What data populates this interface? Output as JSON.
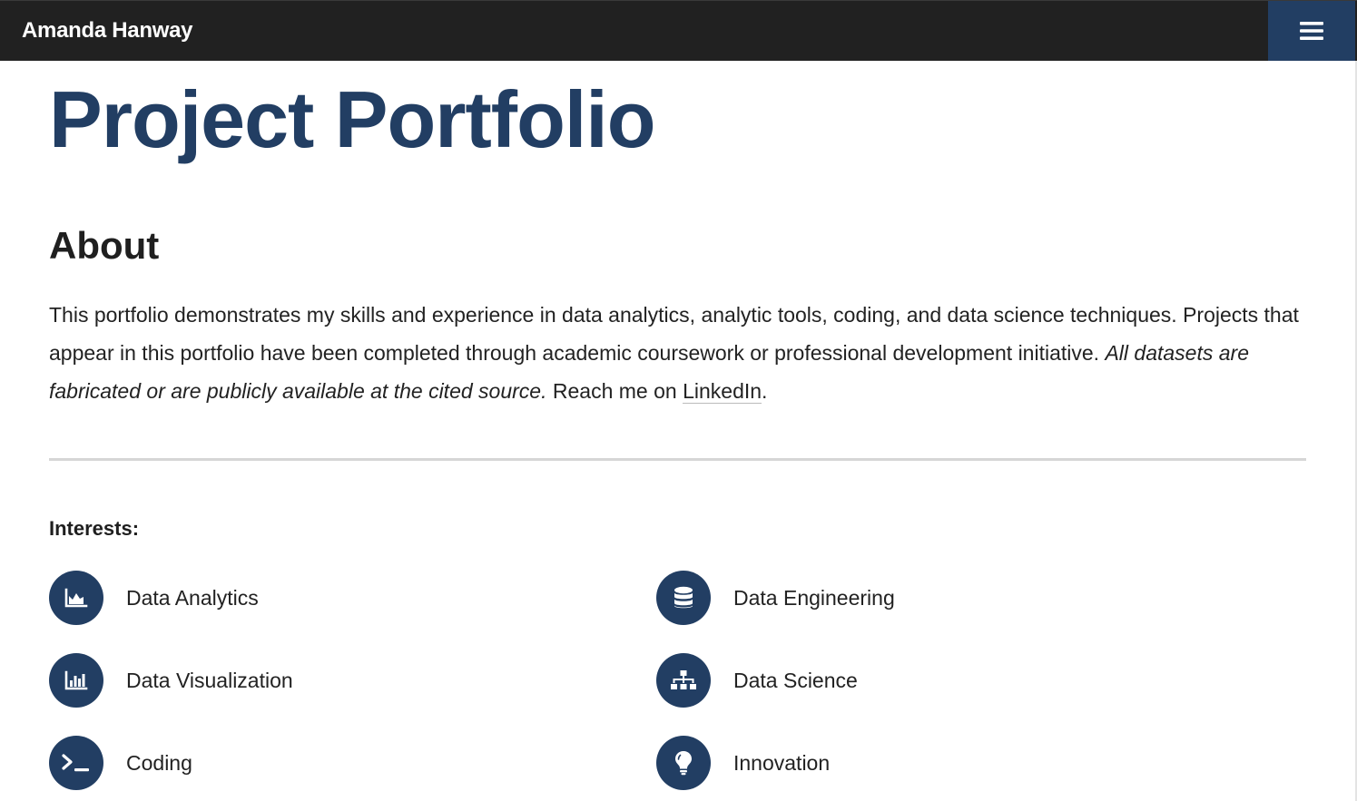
{
  "navbar": {
    "brand": "Amanda Hanway",
    "menu_icon": "hamburger-menu-icon"
  },
  "page": {
    "title": "Project Portfolio"
  },
  "about": {
    "heading": "About",
    "text_part1": "This portfolio demonstrates my skills and experience in data analytics, analytic tools, coding, and data science techniques. Projects that appear in this portfolio have been completed through academic coursework or professional development initiative. ",
    "text_italic": "All datasets are fabricated or are publicly available at the cited source.",
    "text_part2": " Reach me on ",
    "link_label": "LinkedIn",
    "text_end": "."
  },
  "interests": {
    "heading": "Interests:",
    "items": [
      {
        "label": "Data Analytics",
        "icon": "area-chart-icon"
      },
      {
        "label": "Data Engineering",
        "icon": "database-icon"
      },
      {
        "label": "Data Visualization",
        "icon": "bar-chart-icon"
      },
      {
        "label": "Data Science",
        "icon": "sitemap-icon"
      },
      {
        "label": "Coding",
        "icon": "terminal-icon"
      },
      {
        "label": "Innovation",
        "icon": "lightbulb-icon"
      }
    ]
  },
  "colors": {
    "navbar_bg": "#212121",
    "accent": "#223e63",
    "text": "#222222"
  }
}
